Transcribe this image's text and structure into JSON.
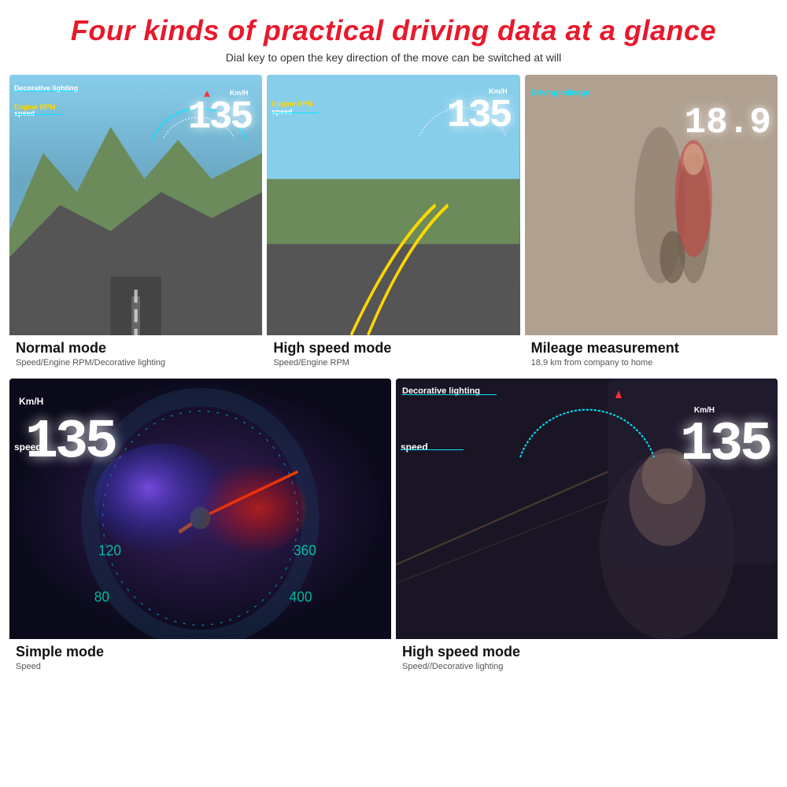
{
  "header": {
    "main_title": "Four kinds of practical driving data at a glance",
    "subtitle": "Dial key to open the key direction of the move can be switched at will"
  },
  "cards": [
    {
      "id": "normal-mode",
      "mode_label": "Normal mode",
      "desc": "Speed/Engine RPM/Decorative lighting",
      "speed": "135",
      "unit": "Km/H",
      "labels": [
        "Decorative lighting",
        "Engine RPM",
        "speed"
      ],
      "type": "road"
    },
    {
      "id": "high-speed-mode-1",
      "mode_label": "High speed mode",
      "desc": "Speed/Engine RPM",
      "speed": "135",
      "unit": "Km/H",
      "labels": [
        "Engine RPM",
        "speed"
      ],
      "type": "mountain"
    },
    {
      "id": "mileage-mode",
      "mode_label": "Mileage measurement",
      "desc": "18.9 km from company to home",
      "speed": "18.9",
      "unit": "",
      "labels": [
        "Driving mileage"
      ],
      "type": "family"
    },
    {
      "id": "simple-mode",
      "mode_label": "Simple mode",
      "desc": "Speed",
      "speed": "135",
      "unit": "Km/H",
      "labels": [
        "speed"
      ],
      "type": "dark-car"
    },
    {
      "id": "high-speed-mode-2",
      "mode_label": "High speed mode",
      "desc": "Speed//Decorative lighting",
      "speed": "135",
      "unit": "Km/H",
      "labels": [
        "Decorative lighting",
        "speed"
      ],
      "type": "interior"
    }
  ],
  "colors": {
    "title_red": "#e8192c",
    "cyan": "#00e5ff",
    "white": "#ffffff",
    "yellow": "#ffd700"
  }
}
